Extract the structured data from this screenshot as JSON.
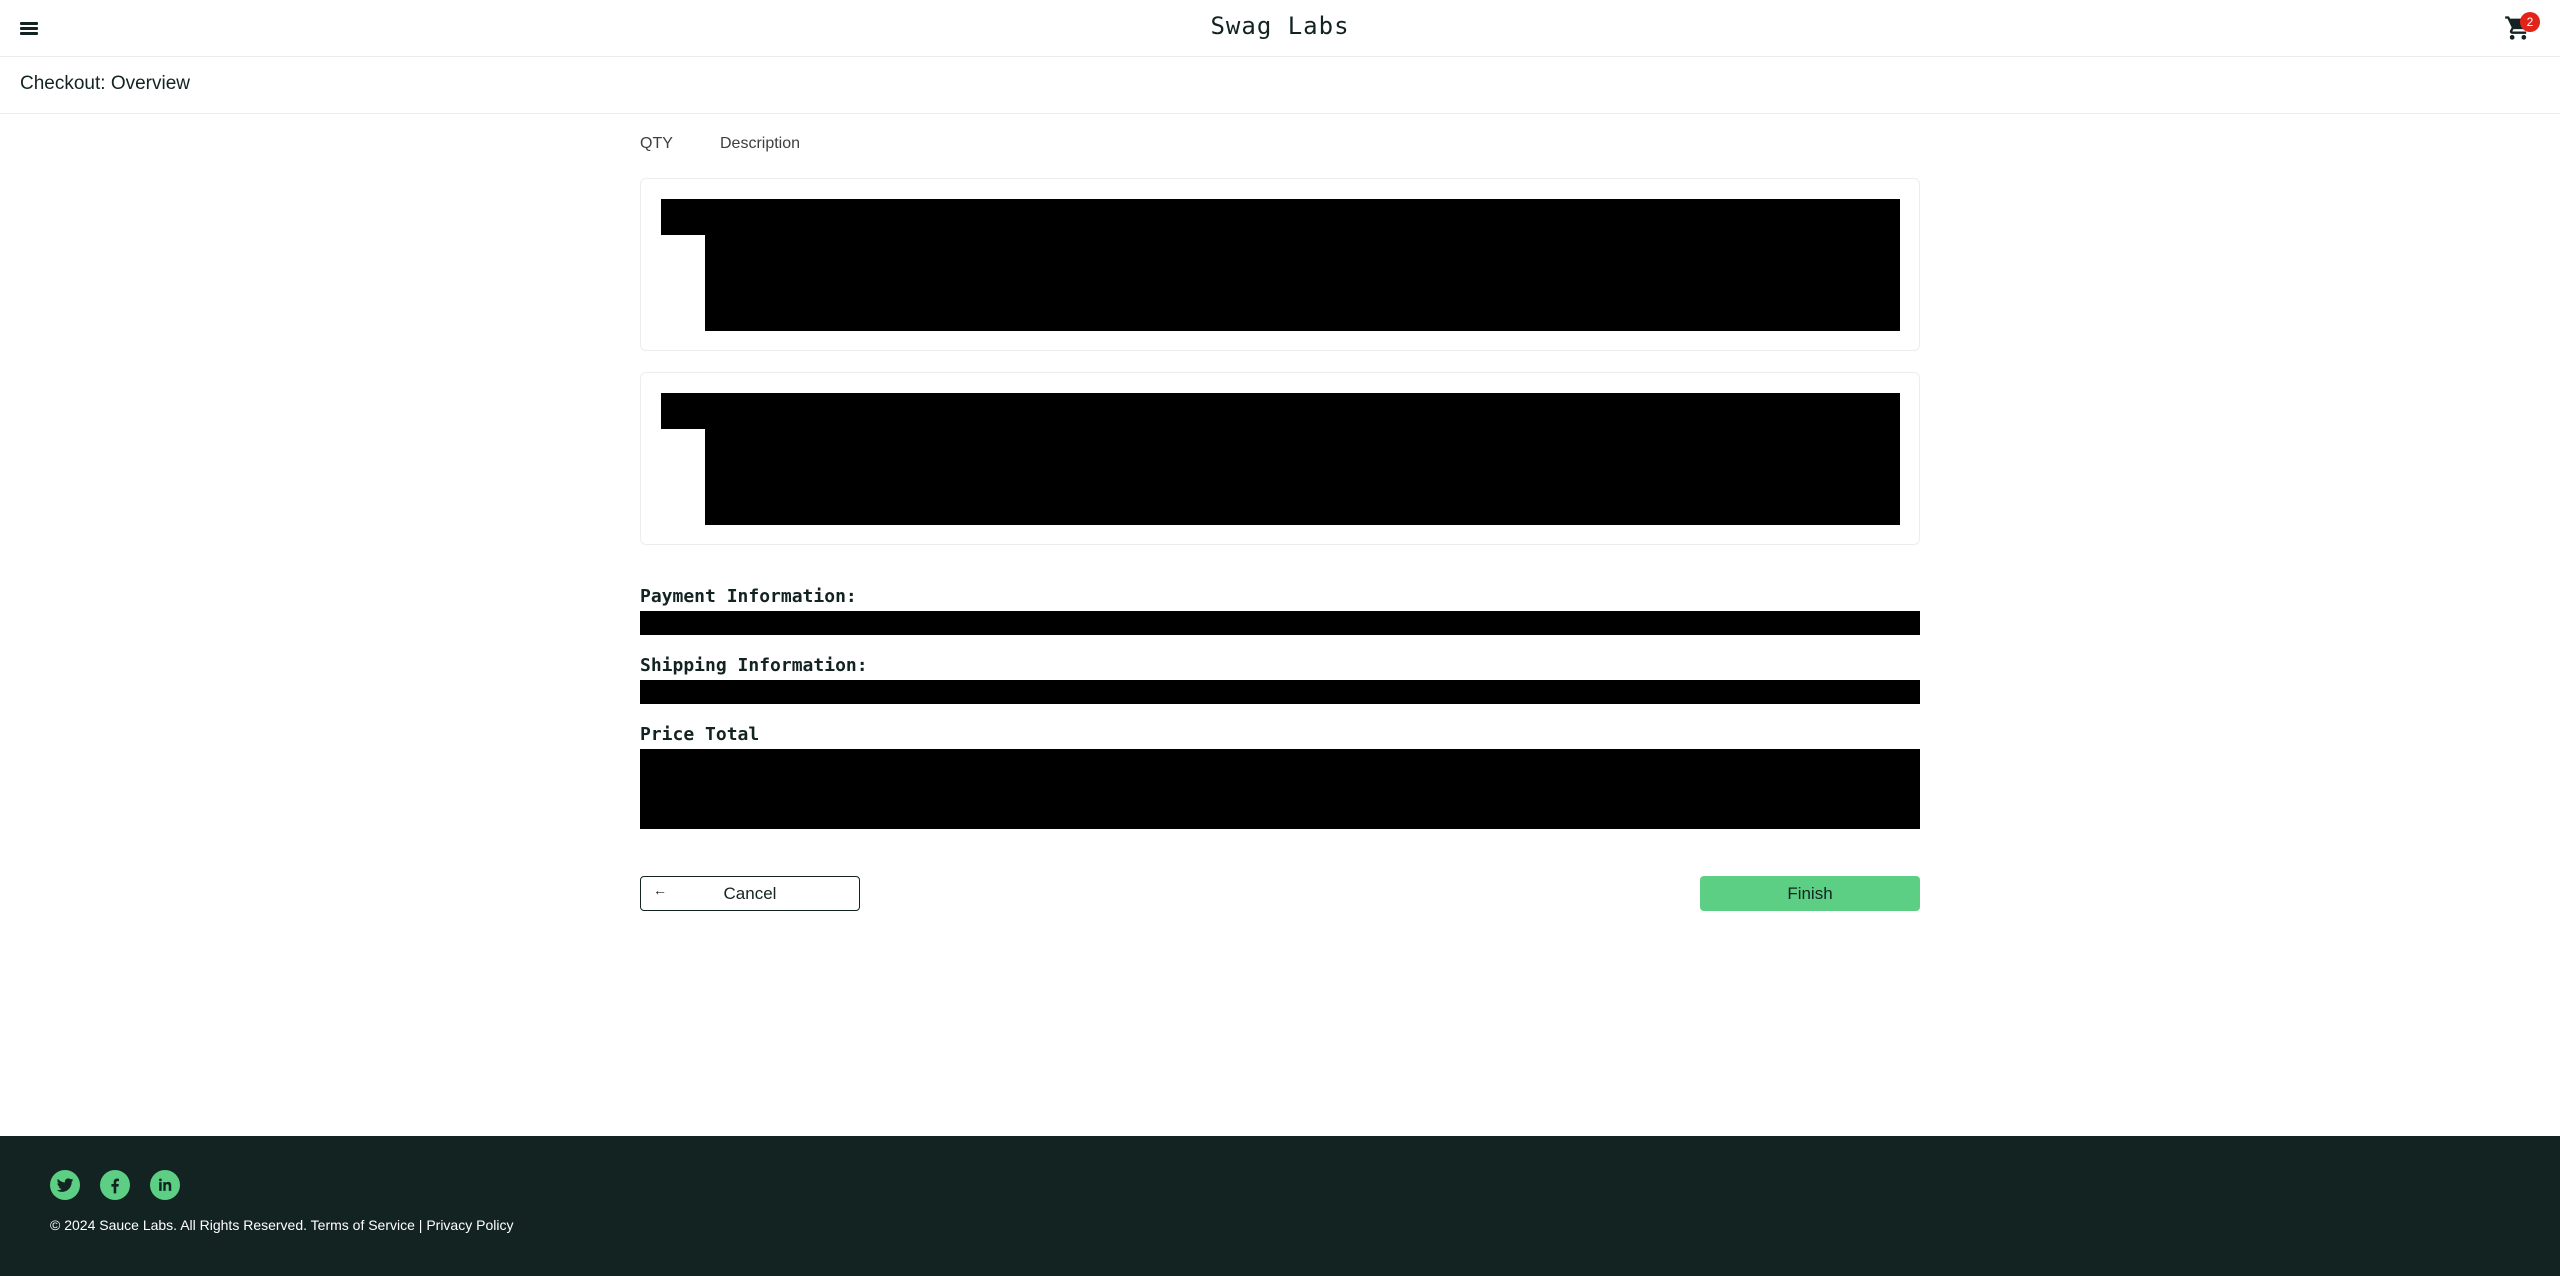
{
  "header": {
    "title": "Swag Labs",
    "menu_icon": "hamburger-menu-icon",
    "cart_icon": "shopping-cart-icon",
    "cart_count": "2"
  },
  "subheader": {
    "title": "Checkout: Overview"
  },
  "columns": {
    "qty": "QTY",
    "description": "Description"
  },
  "summary": {
    "payment_label": "Payment Information:",
    "shipping_label": "Shipping Information:",
    "price_label": "Price Total"
  },
  "actions": {
    "cancel": "Cancel",
    "cancel_icon": "arrow-left-icon",
    "finish": "Finish"
  },
  "footer": {
    "social": [
      "twitter-icon",
      "facebook-icon",
      "linkedin-icon"
    ],
    "copyright": "© 2024 Sauce Labs. All Rights Reserved. Terms of Service | Privacy Policy"
  },
  "colors": {
    "accent": "#5ccf84",
    "dark": "#132322",
    "badge": "#e2231a",
    "redaction": "#000000"
  }
}
